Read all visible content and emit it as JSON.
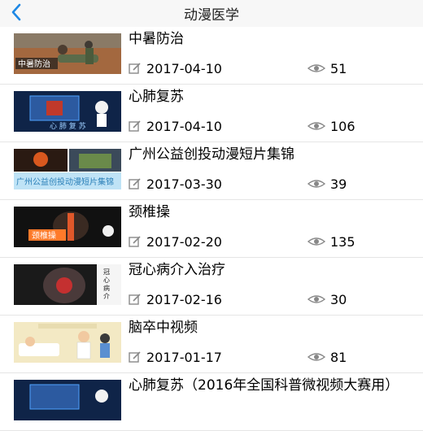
{
  "header": {
    "title": "动漫医学",
    "back_icon": "chevron-left-icon"
  },
  "items": [
    {
      "title": "中暑防治",
      "date": "2017-04-10",
      "views": "51",
      "thumb_caption": "中暑防治"
    },
    {
      "title": "心肺复苏",
      "date": "2017-04-10",
      "views": "106",
      "thumb_caption": "心 肺 复 苏"
    },
    {
      "title": "广州公益创投动漫短片集锦",
      "date": "2017-03-30",
      "views": "39",
      "thumb_caption": "广州公益创投动漫短片集锦"
    },
    {
      "title": "颈椎操",
      "date": "2017-02-20",
      "views": "135",
      "thumb_caption": "颈椎操"
    },
    {
      "title": "冠心病介入治疗",
      "date": "2017-02-16",
      "views": "30",
      "thumb_caption": "冠心病介入治疗"
    },
    {
      "title": "脑卒中视频",
      "date": "2017-01-17",
      "views": "81",
      "thumb_caption": ""
    },
    {
      "title": "心肺复苏（2016年全国科普微视频大赛用）",
      "date": "",
      "views": "",
      "thumb_caption": ""
    }
  ],
  "colors": {
    "accent": "#1e88e5",
    "icon_gray": "#888888"
  }
}
